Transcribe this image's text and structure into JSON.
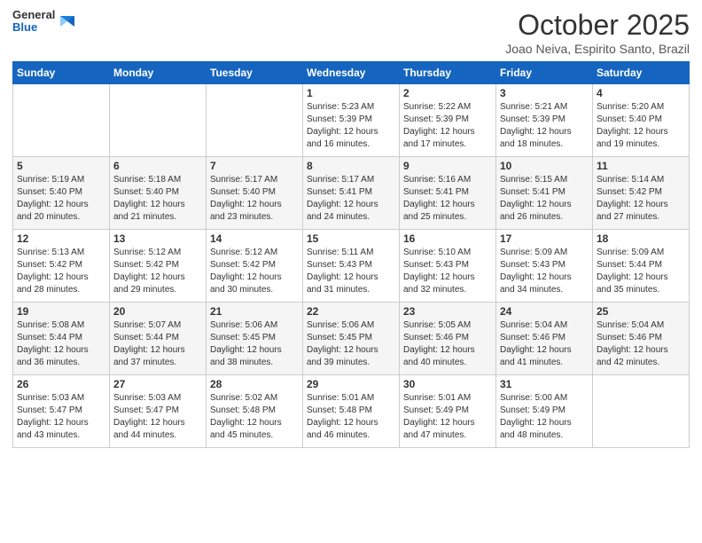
{
  "header": {
    "logo_general": "General",
    "logo_blue": "Blue",
    "month": "October 2025",
    "location": "Joao Neiva, Espirito Santo, Brazil"
  },
  "days_of_week": [
    "Sunday",
    "Monday",
    "Tuesday",
    "Wednesday",
    "Thursday",
    "Friday",
    "Saturday"
  ],
  "weeks": [
    [
      {
        "day": "",
        "content": ""
      },
      {
        "day": "",
        "content": ""
      },
      {
        "day": "",
        "content": ""
      },
      {
        "day": "1",
        "content": "Sunrise: 5:23 AM\nSunset: 5:39 PM\nDaylight: 12 hours\nand 16 minutes."
      },
      {
        "day": "2",
        "content": "Sunrise: 5:22 AM\nSunset: 5:39 PM\nDaylight: 12 hours\nand 17 minutes."
      },
      {
        "day": "3",
        "content": "Sunrise: 5:21 AM\nSunset: 5:39 PM\nDaylight: 12 hours\nand 18 minutes."
      },
      {
        "day": "4",
        "content": "Sunrise: 5:20 AM\nSunset: 5:40 PM\nDaylight: 12 hours\nand 19 minutes."
      }
    ],
    [
      {
        "day": "5",
        "content": "Sunrise: 5:19 AM\nSunset: 5:40 PM\nDaylight: 12 hours\nand 20 minutes."
      },
      {
        "day": "6",
        "content": "Sunrise: 5:18 AM\nSunset: 5:40 PM\nDaylight: 12 hours\nand 21 minutes."
      },
      {
        "day": "7",
        "content": "Sunrise: 5:17 AM\nSunset: 5:40 PM\nDaylight: 12 hours\nand 23 minutes."
      },
      {
        "day": "8",
        "content": "Sunrise: 5:17 AM\nSunset: 5:41 PM\nDaylight: 12 hours\nand 24 minutes."
      },
      {
        "day": "9",
        "content": "Sunrise: 5:16 AM\nSunset: 5:41 PM\nDaylight: 12 hours\nand 25 minutes."
      },
      {
        "day": "10",
        "content": "Sunrise: 5:15 AM\nSunset: 5:41 PM\nDaylight: 12 hours\nand 26 minutes."
      },
      {
        "day": "11",
        "content": "Sunrise: 5:14 AM\nSunset: 5:42 PM\nDaylight: 12 hours\nand 27 minutes."
      }
    ],
    [
      {
        "day": "12",
        "content": "Sunrise: 5:13 AM\nSunset: 5:42 PM\nDaylight: 12 hours\nand 28 minutes."
      },
      {
        "day": "13",
        "content": "Sunrise: 5:12 AM\nSunset: 5:42 PM\nDaylight: 12 hours\nand 29 minutes."
      },
      {
        "day": "14",
        "content": "Sunrise: 5:12 AM\nSunset: 5:42 PM\nDaylight: 12 hours\nand 30 minutes."
      },
      {
        "day": "15",
        "content": "Sunrise: 5:11 AM\nSunset: 5:43 PM\nDaylight: 12 hours\nand 31 minutes."
      },
      {
        "day": "16",
        "content": "Sunrise: 5:10 AM\nSunset: 5:43 PM\nDaylight: 12 hours\nand 32 minutes."
      },
      {
        "day": "17",
        "content": "Sunrise: 5:09 AM\nSunset: 5:43 PM\nDaylight: 12 hours\nand 34 minutes."
      },
      {
        "day": "18",
        "content": "Sunrise: 5:09 AM\nSunset: 5:44 PM\nDaylight: 12 hours\nand 35 minutes."
      }
    ],
    [
      {
        "day": "19",
        "content": "Sunrise: 5:08 AM\nSunset: 5:44 PM\nDaylight: 12 hours\nand 36 minutes."
      },
      {
        "day": "20",
        "content": "Sunrise: 5:07 AM\nSunset: 5:44 PM\nDaylight: 12 hours\nand 37 minutes."
      },
      {
        "day": "21",
        "content": "Sunrise: 5:06 AM\nSunset: 5:45 PM\nDaylight: 12 hours\nand 38 minutes."
      },
      {
        "day": "22",
        "content": "Sunrise: 5:06 AM\nSunset: 5:45 PM\nDaylight: 12 hours\nand 39 minutes."
      },
      {
        "day": "23",
        "content": "Sunrise: 5:05 AM\nSunset: 5:46 PM\nDaylight: 12 hours\nand 40 minutes."
      },
      {
        "day": "24",
        "content": "Sunrise: 5:04 AM\nSunset: 5:46 PM\nDaylight: 12 hours\nand 41 minutes."
      },
      {
        "day": "25",
        "content": "Sunrise: 5:04 AM\nSunset: 5:46 PM\nDaylight: 12 hours\nand 42 minutes."
      }
    ],
    [
      {
        "day": "26",
        "content": "Sunrise: 5:03 AM\nSunset: 5:47 PM\nDaylight: 12 hours\nand 43 minutes."
      },
      {
        "day": "27",
        "content": "Sunrise: 5:03 AM\nSunset: 5:47 PM\nDaylight: 12 hours\nand 44 minutes."
      },
      {
        "day": "28",
        "content": "Sunrise: 5:02 AM\nSunset: 5:48 PM\nDaylight: 12 hours\nand 45 minutes."
      },
      {
        "day": "29",
        "content": "Sunrise: 5:01 AM\nSunset: 5:48 PM\nDaylight: 12 hours\nand 46 minutes."
      },
      {
        "day": "30",
        "content": "Sunrise: 5:01 AM\nSunset: 5:49 PM\nDaylight: 12 hours\nand 47 minutes."
      },
      {
        "day": "31",
        "content": "Sunrise: 5:00 AM\nSunset: 5:49 PM\nDaylight: 12 hours\nand 48 minutes."
      },
      {
        "day": "",
        "content": ""
      }
    ]
  ]
}
